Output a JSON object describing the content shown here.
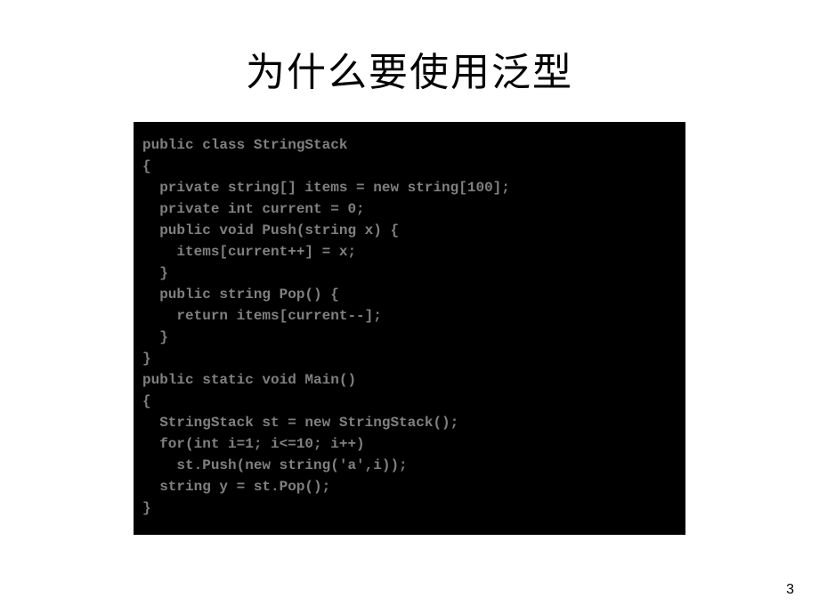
{
  "title": "为什么要使用泛型",
  "code": {
    "lines": [
      "public class StringStack",
      "{",
      "  private string[] items = new string[100];",
      "  private int current = 0;",
      "  public void Push(string x) {",
      "    items[current++] = x;",
      "  }",
      "  public string Pop() {",
      "    return items[current--];",
      "  }",
      "}",
      "",
      "public static void Main()",
      "{",
      "  StringStack st = new StringStack();",
      "  for(int i=1; i<=10; i++)",
      "    st.Push(new string('a',i));",
      "  string y = st.Pop();",
      "}"
    ]
  },
  "pageNumber": "3"
}
